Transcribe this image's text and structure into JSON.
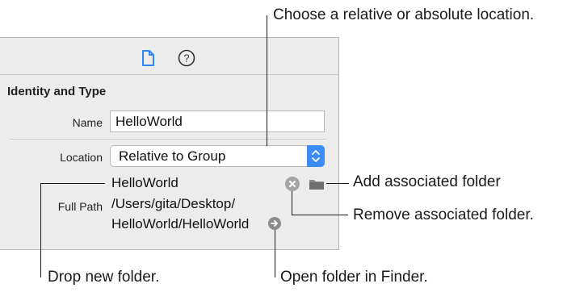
{
  "toolbar": {
    "items": [
      "file-inspector-icon",
      "quick-help-icon"
    ],
    "help_glyph": "?"
  },
  "section": {
    "title": "Identity and Type"
  },
  "name_field": {
    "label": "Name",
    "value": "HelloWorld"
  },
  "location": {
    "label": "Location",
    "selected": "Relative to Group"
  },
  "folder_row": {
    "value": "HelloWorld"
  },
  "full_path": {
    "label": "Full Path",
    "line1": "/Users/gita/Desktop/",
    "line2": "HelloWorld/HelloWorld"
  },
  "callouts": {
    "choose_location": "Choose a relative or absolute location.",
    "add_folder": "Add associated folder",
    "remove_folder": "Remove associated folder.",
    "drop_folder": "Drop new folder.",
    "open_finder": "Open folder in Finder."
  },
  "colors": {
    "panel_bg": "#ececec",
    "accent_blue": "#3b8df4",
    "button_gray": "#a5a5a5"
  }
}
